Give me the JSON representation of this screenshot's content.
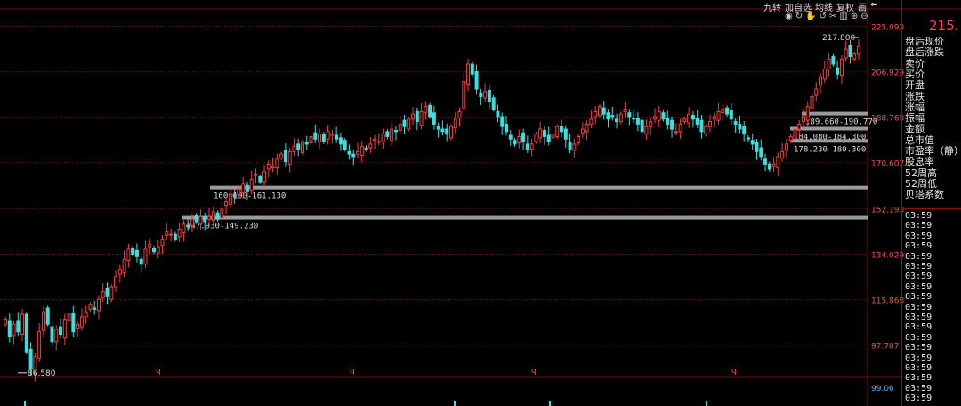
{
  "toolbar": {
    "items": [
      "九转",
      "加自选",
      "均线",
      "复权",
      "画",
      "⬅"
    ]
  },
  "icons": [
    "eye-icon",
    "redo-icon",
    "hand-icon",
    "undo-icon",
    "scissors-icon",
    "delete-icon",
    "zoom-in-icon",
    "zoom-out-icon"
  ],
  "big_price": "215.",
  "panel": {
    "labels": [
      "盘后现价",
      "盘后涨跌",
      "卖价",
      "买价",
      "开盘",
      "涨跌",
      "涨幅",
      "振幅",
      "金额",
      "总市值",
      "市盈率（静）",
      "股息率",
      "52周高",
      "52周低",
      "贝塔系数"
    ],
    "times": [
      "03:59",
      "03:59",
      "03:59",
      "03:59",
      "03:59",
      "03:59",
      "03:59",
      "03:59",
      "03:59",
      "03:59",
      "03:59",
      "03:59",
      "03:59",
      "03:59",
      "03:59",
      "03:59",
      "03:59",
      "03:59",
      "03:59"
    ]
  },
  "colors": {
    "up": "#ff3b3b",
    "down": "#38e0e0",
    "grid": "#7a0e0e",
    "axis_text": "#ff4a4a",
    "zone": "#9a9a9a"
  },
  "chart_data": {
    "type": "candlestick",
    "y_ticks": [
      225.09,
      206.929,
      188.768,
      170.607,
      152.19,
      134.029,
      115.868,
      97.707
    ],
    "y_tick_labels": [
      "225.090",
      "206.929",
      "188.768",
      "170.607",
      "152.190",
      "134.029",
      "115.868",
      "97.707"
    ],
    "ylim": [
      89.0,
      226.0
    ],
    "volume_axis_label": "99.06",
    "x_markers": [
      "q",
      "q",
      "q",
      "q"
    ],
    "annotations": {
      "low": {
        "value": 86.58,
        "label": "86.580"
      },
      "high": {
        "value": 217.8,
        "label": "217.800"
      }
    },
    "zones": [
      {
        "label": "147.930-149.230",
        "value": 148.58
      },
      {
        "label": "160.190-161.130",
        "value": 160.66
      },
      {
        "label": "178.230-180.300",
        "value": 179.27
      },
      {
        "label": "184.080-184.300",
        "value": 184.19
      },
      {
        "label": "189.660-190.770",
        "value": 190.2
      }
    ],
    "closes": [
      108,
      101,
      106,
      103,
      110,
      95,
      88,
      93,
      103,
      111,
      106,
      99,
      104,
      102,
      108,
      110,
      103,
      106,
      109,
      111,
      114,
      112,
      116,
      119,
      117,
      121,
      125,
      128,
      132,
      136,
      134,
      133,
      130,
      136,
      138,
      135,
      137,
      140,
      143,
      142,
      140,
      144,
      146,
      145,
      148,
      147,
      149,
      147,
      149,
      151,
      148,
      152,
      155,
      158,
      157,
      160,
      162,
      159,
      164,
      166,
      163,
      167,
      170,
      169,
      172,
      174,
      171,
      175,
      177,
      176,
      179,
      178,
      181,
      180,
      182,
      179,
      183,
      182,
      180,
      178,
      176,
      174,
      173,
      175,
      177,
      176,
      178,
      180,
      179,
      182,
      181,
      184,
      183,
      186,
      185,
      188,
      190,
      187,
      191,
      193,
      189,
      186,
      184,
      183,
      182,
      185,
      188,
      191,
      203,
      210,
      206,
      200,
      197,
      199,
      195,
      192,
      189,
      185,
      183,
      180,
      178,
      181,
      179,
      176,
      178,
      182,
      184,
      181,
      179,
      182,
      185,
      183,
      180,
      176,
      178,
      181,
      184,
      186,
      188,
      191,
      193,
      190,
      188,
      189,
      187,
      190,
      192,
      189,
      188,
      186,
      183,
      185,
      187,
      189,
      191,
      188,
      186,
      184,
      183,
      186,
      188,
      190,
      188,
      186,
      183,
      185,
      187,
      189,
      191,
      192,
      190,
      188,
      186,
      184,
      182,
      180,
      178,
      175,
      173,
      170,
      168,
      170,
      173,
      175,
      178,
      181,
      184,
      186,
      189,
      193,
      197,
      200,
      205,
      208,
      212,
      210,
      206,
      212,
      216,
      213,
      214,
      217
    ]
  }
}
